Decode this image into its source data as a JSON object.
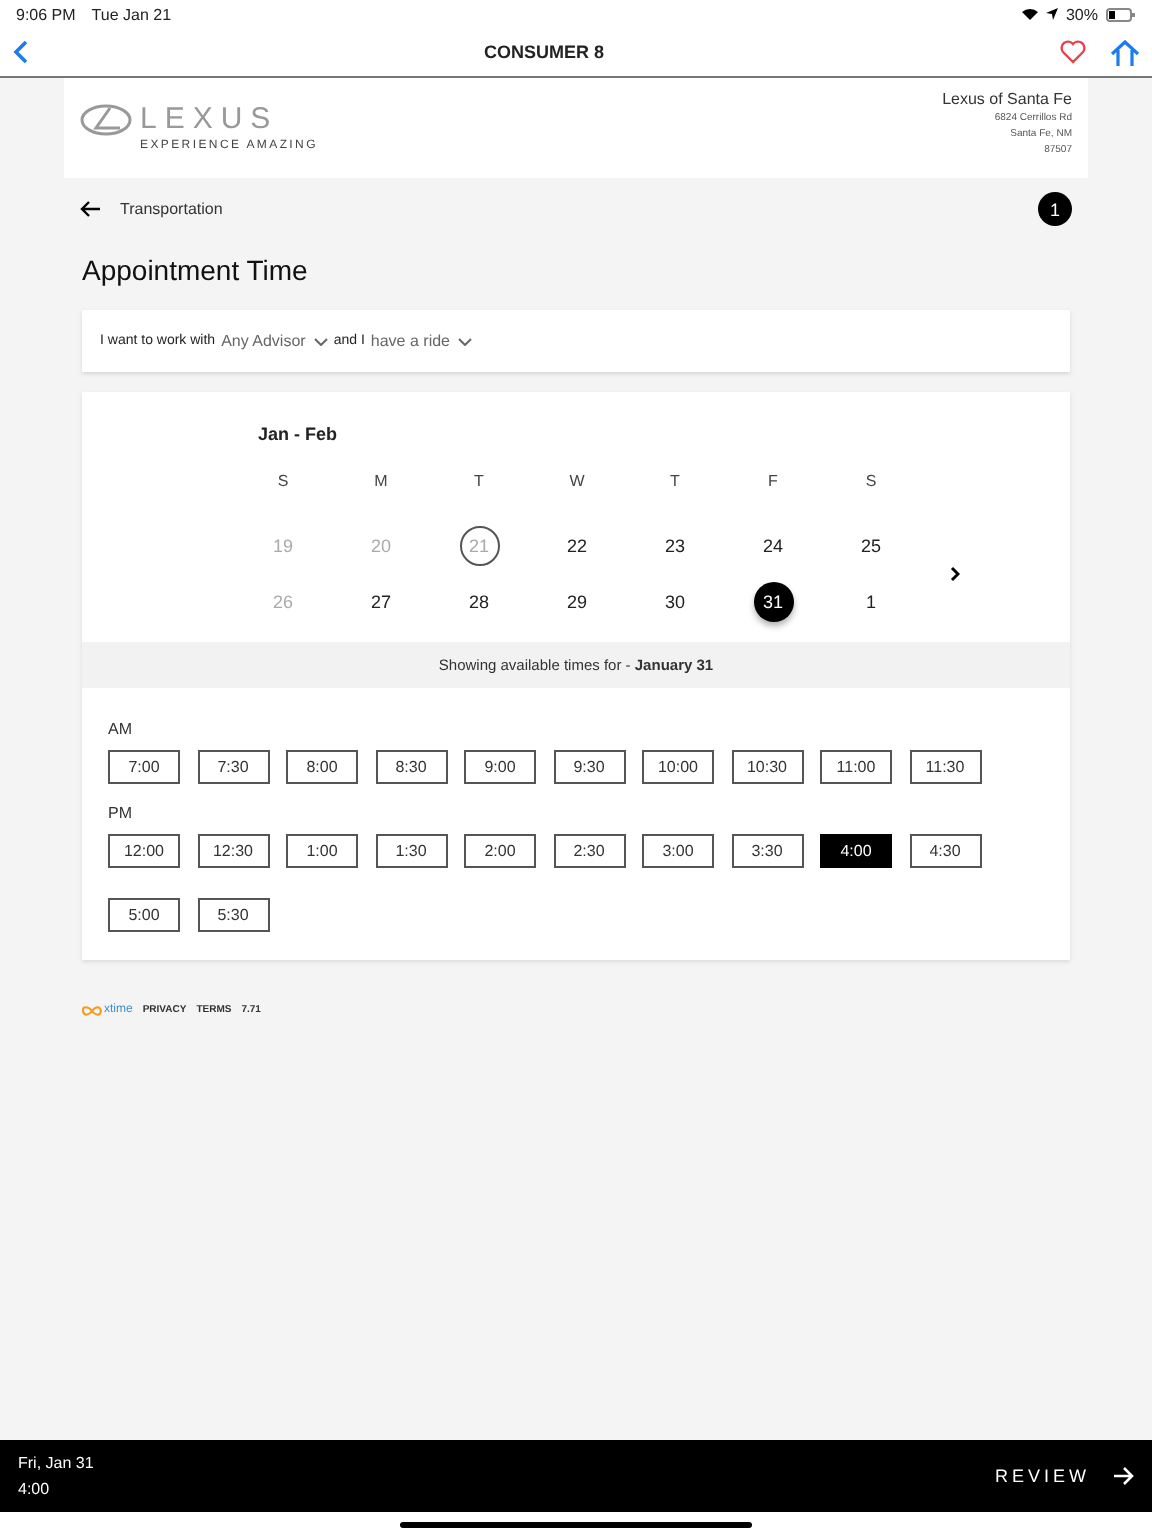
{
  "status_bar": {
    "time": "9:06 PM",
    "date": "Tue Jan 21",
    "battery": "30%"
  },
  "nav": {
    "title": "CONSUMER 8"
  },
  "dealer": {
    "logo_word": "LEXUS",
    "tagline": "EXPERIENCE AMAZING",
    "name": "Lexus of Santa Fe",
    "address": [
      "6824 Cerrillos Rd",
      "Santa Fe, NM",
      "87507"
    ]
  },
  "step": {
    "label": "Transportation",
    "badge": "1"
  },
  "page_title": "Appointment Time",
  "filter": {
    "prefix": "I want to work with",
    "advisor": "Any Advisor",
    "middle": "and I",
    "ride": "have a ride"
  },
  "calendar": {
    "month": "Jan - Feb",
    "weekdays": [
      "S",
      "M",
      "T",
      "W",
      "T",
      "F",
      "S"
    ],
    "weeks": [
      [
        {
          "day": "19",
          "disabled": true,
          "today": false,
          "selected": false
        },
        {
          "day": "20",
          "disabled": true,
          "today": false,
          "selected": false
        },
        {
          "day": "21",
          "disabled": true,
          "today": true,
          "selected": false
        },
        {
          "day": "22",
          "disabled": false,
          "today": false,
          "selected": false
        },
        {
          "day": "23",
          "disabled": false,
          "today": false,
          "selected": false
        },
        {
          "day": "24",
          "disabled": false,
          "today": false,
          "selected": false
        },
        {
          "day": "25",
          "disabled": false,
          "today": false,
          "selected": false
        }
      ],
      [
        {
          "day": "26",
          "disabled": true,
          "today": false,
          "selected": false
        },
        {
          "day": "27",
          "disabled": false,
          "today": false,
          "selected": false
        },
        {
          "day": "28",
          "disabled": false,
          "today": false,
          "selected": false
        },
        {
          "day": "29",
          "disabled": false,
          "today": false,
          "selected": false
        },
        {
          "day": "30",
          "disabled": false,
          "today": false,
          "selected": false
        },
        {
          "day": "31",
          "disabled": false,
          "today": false,
          "selected": true
        },
        {
          "day": "1",
          "disabled": false,
          "today": false,
          "selected": false
        }
      ]
    ]
  },
  "availability": {
    "prefix": "Showing available times for -",
    "date": "January 31"
  },
  "time_groups": [
    {
      "label": "AM",
      "times": [
        {
          "time": "7:00",
          "selected": false
        },
        {
          "time": "7:30",
          "selected": false
        },
        {
          "time": "8:00",
          "selected": false
        },
        {
          "time": "8:30",
          "selected": false
        },
        {
          "time": "9:00",
          "selected": false
        },
        {
          "time": "9:30",
          "selected": false
        },
        {
          "time": "10:00",
          "selected": false
        },
        {
          "time": "10:30",
          "selected": false
        },
        {
          "time": "11:00",
          "selected": false
        },
        {
          "time": "11:30",
          "selected": false
        }
      ]
    },
    {
      "label": "PM",
      "times": [
        {
          "time": "12:00",
          "selected": false
        },
        {
          "time": "12:30",
          "selected": false
        },
        {
          "time": "1:00",
          "selected": false
        },
        {
          "time": "1:30",
          "selected": false
        },
        {
          "time": "2:00",
          "selected": false
        },
        {
          "time": "2:30",
          "selected": false
        },
        {
          "time": "3:00",
          "selected": false
        },
        {
          "time": "3:30",
          "selected": false
        },
        {
          "time": "4:00",
          "selected": true
        },
        {
          "time": "4:30",
          "selected": false
        },
        {
          "time": "5:00",
          "selected": false
        },
        {
          "time": "5:30",
          "selected": false
        }
      ]
    }
  ],
  "footer": {
    "brand": "xtime",
    "links": [
      "PRIVACY",
      "TERMS"
    ],
    "version": "7.71"
  },
  "bottom_bar": {
    "date": "Fri, Jan 31",
    "time": "4:00",
    "action": "REVIEW"
  }
}
